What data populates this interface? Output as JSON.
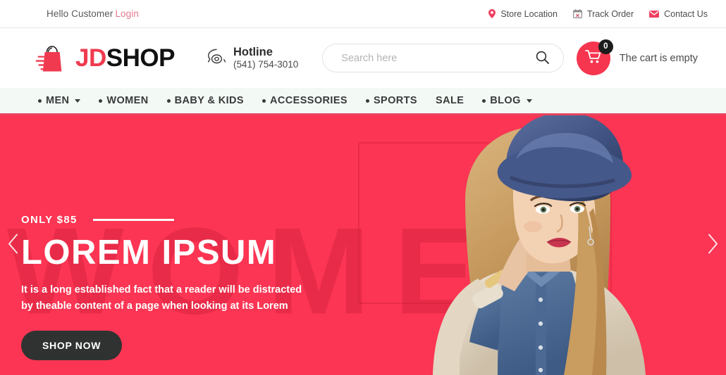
{
  "topbar": {
    "greeting_text": "Hello Customer",
    "login_label": "Login",
    "links": [
      {
        "label": "Store Location",
        "icon": "location-pin-icon"
      },
      {
        "label": "Track Order",
        "icon": "calendar-icon"
      },
      {
        "label": "Contact Us",
        "icon": "envelope-icon"
      }
    ]
  },
  "header": {
    "logo": {
      "brand_first": "JD",
      "brand_second": "SHOP",
      "icon": "shopping-bag-icon"
    },
    "hotline": {
      "icon": "telephone-icon",
      "title": "Hotline",
      "number": "(541) 754-3010"
    },
    "search": {
      "placeholder": "Search here",
      "value": "",
      "icon": "search-icon"
    },
    "cart": {
      "icon": "shopping-cart-icon",
      "count": "0",
      "status": "The cart is empty"
    }
  },
  "nav": {
    "items": [
      {
        "label": "MEN",
        "bullet": true,
        "caret": true
      },
      {
        "label": "WOMEN",
        "bullet": true,
        "caret": false
      },
      {
        "label": "BABY & KIDS",
        "bullet": true,
        "caret": false
      },
      {
        "label": "ACCESSORIES",
        "bullet": true,
        "caret": false
      },
      {
        "label": "SPORTS",
        "bullet": true,
        "caret": false
      },
      {
        "label": "SALE",
        "bullet": false,
        "caret": false
      },
      {
        "label": "BLOG",
        "bullet": true,
        "caret": true
      }
    ]
  },
  "hero": {
    "watermark": "WOMEN",
    "eyebrow": "ONLY $85",
    "title": "LOREM IPSUM",
    "description": "It is a long established fact that a reader will be distracted by theable content of a page when looking at its Lorem",
    "cta_label": "SHOP NOW",
    "prev_icon": "chevron-left-icon",
    "next_icon": "chevron-right-icon"
  },
  "colors": {
    "accent_pink": "#f6354f",
    "hero_bg": "#fb3553",
    "nav_bg": "#f3faf6",
    "nav_border": "#e8455f",
    "cta_dark": "#2f3231",
    "login_pink": "#e4798d"
  }
}
